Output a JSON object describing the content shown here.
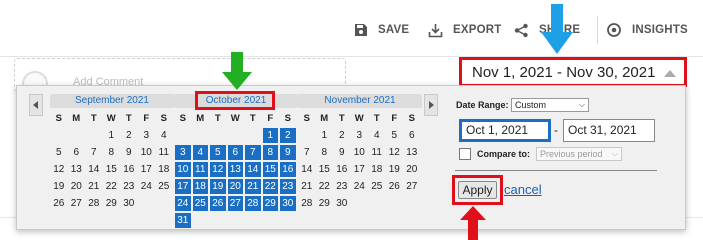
{
  "toolbar": {
    "save_label": "SAVE",
    "export_label": "EXPORT",
    "share_label": "SHARE",
    "insights_label": "INSIGHTS"
  },
  "background": {
    "comment_placeholder": "Add Comment"
  },
  "date_range": {
    "display": "Nov 1, 2021 - Nov 30, 2021"
  },
  "calendar": {
    "dow": [
      "S",
      "M",
      "T",
      "W",
      "T",
      "F",
      "S"
    ],
    "months": [
      {
        "title": "September 2021",
        "days": [
          "",
          "",
          "",
          "1",
          "2",
          "3",
          "4",
          "5",
          "6",
          "7",
          "8",
          "9",
          "10",
          "11",
          "12",
          "13",
          "14",
          "15",
          "16",
          "17",
          "18",
          "19",
          "20",
          "21",
          "22",
          "23",
          "24",
          "25",
          "26",
          "27",
          "28",
          "29",
          "30",
          ""
        ],
        "selected": []
      },
      {
        "title": "October 2021",
        "days": [
          "",
          "",
          "",
          "",
          "",
          "1",
          "2",
          "3",
          "4",
          "5",
          "6",
          "7",
          "8",
          "9",
          "10",
          "11",
          "12",
          "13",
          "14",
          "15",
          "16",
          "17",
          "18",
          "19",
          "20",
          "21",
          "22",
          "23",
          "24",
          "25",
          "26",
          "27",
          "28",
          "29",
          "30",
          "31"
        ],
        "selected": [
          "1",
          "2",
          "3",
          "4",
          "5",
          "6",
          "7",
          "8",
          "9",
          "10",
          "11",
          "12",
          "13",
          "14",
          "15",
          "16",
          "17",
          "18",
          "19",
          "20",
          "21",
          "22",
          "23",
          "24",
          "25",
          "26",
          "27",
          "28",
          "29",
          "30",
          "31"
        ]
      },
      {
        "title": "November 2021",
        "days": [
          "",
          "1",
          "2",
          "3",
          "4",
          "5",
          "6",
          "7",
          "8",
          "9",
          "10",
          "11",
          "12",
          "13",
          "14",
          "15",
          "16",
          "17",
          "18",
          "19",
          "20",
          "21",
          "22",
          "23",
          "24",
          "25",
          "26",
          "27",
          "28",
          "29",
          "30"
        ],
        "selected": []
      }
    ]
  },
  "controls": {
    "date_range_label": "Date Range:",
    "date_range_value": "Custom",
    "from_date": "Oct 1, 2021",
    "dash": "-",
    "to_date": "Oct 31, 2021",
    "compare_label": "Compare to:",
    "compare_value": "Previous period",
    "apply_label": "Apply",
    "cancel_label": "cancel"
  },
  "colors": {
    "accent_blue": "#1a6fc4",
    "highlight_red": "#e0101a",
    "arrow_green": "#22b022",
    "arrow_cyan": "#1ea0e6"
  }
}
